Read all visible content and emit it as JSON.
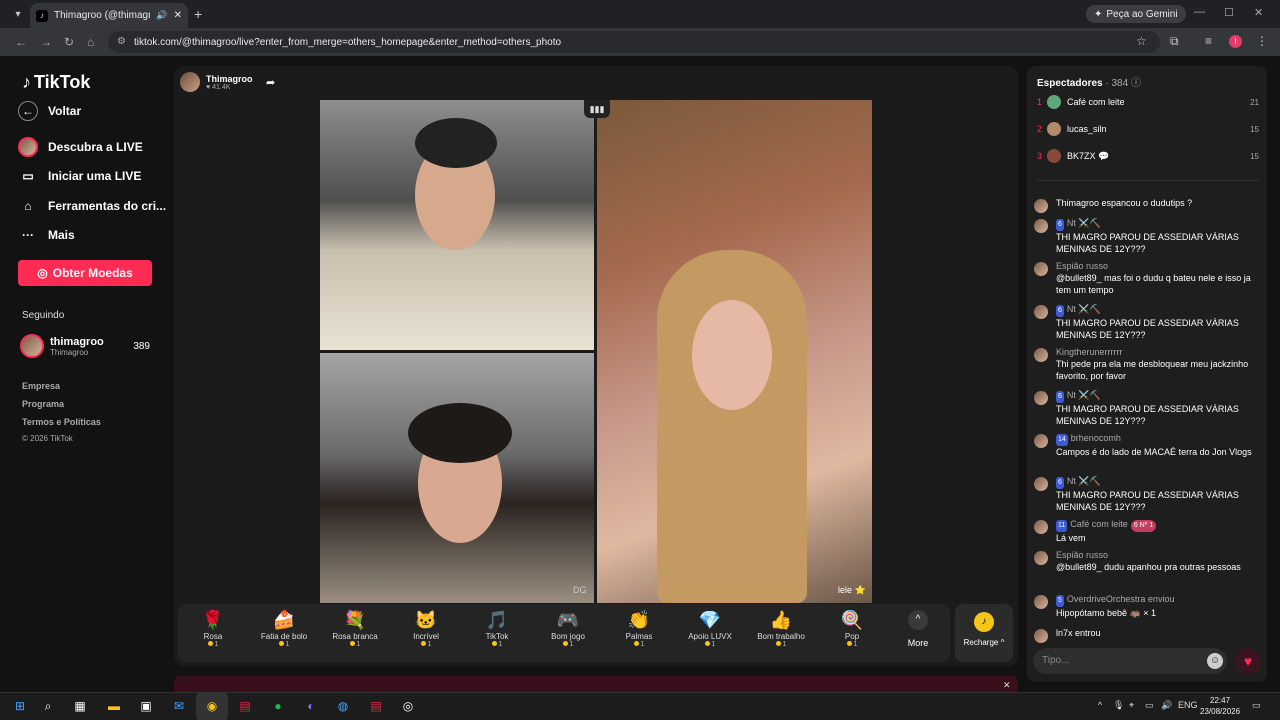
{
  "browser": {
    "tab_title": "Thimagroo (@thimagroo) está",
    "new_tab": "+",
    "gemini_label": "Peça ao Gemini",
    "url": "tiktok.com/@thimagroo/live?enter_from_merge=others_homepage&enter_method=others_photo",
    "profile_initial": "I"
  },
  "sidebar": {
    "logo": "TikTok",
    "back": "Voltar",
    "nav": [
      {
        "label": "Descubra a LIVE",
        "icon": "live-discover-icon"
      },
      {
        "label": "Iniciar uma LIVE",
        "icon": "camera-icon"
      },
      {
        "label": "Ferramentas do cri...",
        "icon": "creator-tools-icon"
      },
      {
        "label": "Mais",
        "icon": "more-dots-icon"
      }
    ],
    "coins_button": "Obter Moedas",
    "following_title": "Seguindo",
    "following": {
      "name": "thimagroo",
      "handle": "Thimagroo",
      "count": "389"
    },
    "footer": [
      "Empresa",
      "Programa",
      "Termos e Políticas",
      "© 2026 TikTok"
    ]
  },
  "stream": {
    "host_name": "Thimagroo",
    "host_likes": "♥ 41.4K",
    "watermark": "DG",
    "streamer_tag": "lele ⭐"
  },
  "gifts": [
    {
      "name": "Rosa",
      "price": "1",
      "icon": "🌹"
    },
    {
      "name": "Fatia de bolo",
      "price": "1",
      "icon": "🍰"
    },
    {
      "name": "Rosa branca",
      "price": "1",
      "icon": "💐"
    },
    {
      "name": "Incrível",
      "price": "1",
      "icon": "🐱"
    },
    {
      "name": "TikTok",
      "price": "1",
      "icon": "🎵"
    },
    {
      "name": "Bom jogo",
      "price": "1",
      "icon": "🎮"
    },
    {
      "name": "Palmas",
      "price": "1",
      "icon": "👏"
    },
    {
      "name": "Apoio LUVX",
      "price": "1",
      "icon": "💎"
    },
    {
      "name": "Bom trabalho",
      "price": "1",
      "icon": "👍"
    },
    {
      "name": "Pop",
      "price": "1",
      "icon": "🍭"
    }
  ],
  "more_label": "More",
  "recharge_label": "Recharge ^",
  "viewers": {
    "title": "Espectadores",
    "count": "· 384",
    "top": [
      {
        "rank": "1",
        "name": "Café com leite",
        "score": "21",
        "color": "#5fa77a"
      },
      {
        "rank": "2",
        "name": "lucas_siln",
        "score": "15",
        "color": "#b58a6a"
      },
      {
        "rank": "3",
        "name": "BK7ZX 💬",
        "score": "15",
        "color": "#8a4a3a"
      }
    ]
  },
  "chat": [
    {
      "name": "",
      "text": "Thimagroo espancou o dudutips ?",
      "lvl": "",
      "fan": ""
    },
    {
      "name": "Nt ⚔️⛏️",
      "text": "THI MAGRO PAROU DE ASSEDIAR VÁRIAS MENINAS DE 12Y???",
      "lvl": "6",
      "fan": ""
    },
    {
      "name": "Espião russo",
      "text": "@bullet89_ mas foi o dudu q bateu nele e isso ja tem um tempo",
      "lvl": "",
      "fan": ""
    },
    {
      "name": "Nt ⚔️⛏️",
      "text": "THI MAGRO PAROU DE ASSEDIAR VÁRIAS MENINAS DE 12Y???",
      "lvl": "6",
      "fan": ""
    },
    {
      "name": "Kingtherunerrrrrr",
      "text": "Thi pede pra ela me desbloquear meu jackzinho favorito, por favor",
      "lvl": "",
      "fan": ""
    },
    {
      "name": "Nt ⚔️⛏️",
      "text": "THI MAGRO PAROU DE ASSEDIAR VÁRIAS MENINAS DE 12Y???",
      "lvl": "6",
      "fan": ""
    },
    {
      "name": "brhenocomh",
      "text": "Campos é do lado de MACAÉ terra do Jon Vlogs",
      "lvl": "14",
      "fan": ""
    },
    {
      "name": "Nt ⚔️⛏️",
      "text": "THI MAGRO PAROU DE ASSEDIAR VÁRIAS MENINAS DE 12Y???",
      "lvl": "6",
      "fan": ""
    },
    {
      "name": "Café com leite",
      "text": "Lá vem",
      "lvl": "11",
      "fan": "6 Nº 1"
    },
    {
      "name": "Espião russo",
      "text": "@bullet89_ dudu apanhou pra outras pessoas",
      "lvl": "",
      "fan": ""
    },
    {
      "name": "OverdriveOrchestra enviou",
      "text": "Hipopótamo bebê 🦛 × 1",
      "lvl": "5",
      "fan": ""
    },
    {
      "name": "",
      "text": "ln7x entrou",
      "lvl": "",
      "fan": ""
    }
  ],
  "chat_input_placeholder": "Tipo...",
  "taskbar": {
    "lang": "ENG",
    "time": "22:47",
    "date": "23/08/2026"
  }
}
